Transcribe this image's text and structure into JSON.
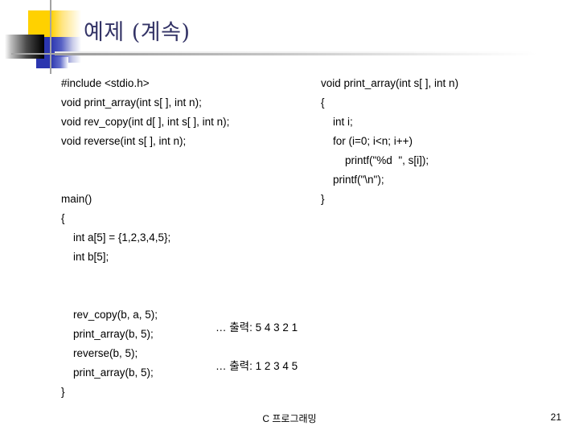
{
  "slide": {
    "title": "예제 (계속)",
    "footer_text": "C 프로그래밍",
    "page_number": "21",
    "colors": {
      "title": "#333366",
      "logo_yellow": "#FFD100",
      "logo_blue": "#2B36AF",
      "rule_gray": "#A3A3A3",
      "body_text": "#000000",
      "background": "#FFFFFF"
    }
  },
  "code_left": [
    "#include <stdio.h>",
    "void print_array(int s[ ], int n);",
    "void rev_copy(int d[ ], int s[ ], int n);",
    "void reverse(int s[ ], int n);",
    "",
    "",
    "main()",
    "{",
    "    int a[5] = {1,2,3,4,5};",
    "    int b[5];",
    "",
    "",
    "    rev_copy(b, a, 5);",
    "    print_array(b, 5);",
    "    reverse(b, 5);",
    "    print_array(b, 5);",
    "}"
  ],
  "code_right": [
    "void print_array(int s[ ], int n)",
    "{",
    "    int i;",
    "    for (i=0; i<n; i++)",
    "        printf(\"%d  \", s[i]);",
    "    printf(\"\\n\");",
    "}"
  ],
  "annotations": [
    "… 출력: 5 4 3 2 1",
    "… 출력: 1 2 3 4 5"
  ]
}
